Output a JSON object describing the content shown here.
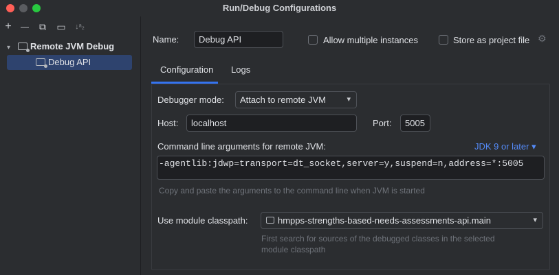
{
  "window": {
    "title": "Run/Debug Configurations"
  },
  "toolbar": {
    "add": "+",
    "remove": "—",
    "copy": "⧉",
    "new_folder": "▭",
    "sort": "↓ᵃ₂"
  },
  "tree": {
    "parent_label": "Remote JVM Debug",
    "child_label": "Debug API"
  },
  "form": {
    "name_label": "Name:",
    "name_value": "Debug API",
    "allow_multiple_label": "Allow multiple instances",
    "store_project_label": "Store as project file",
    "tabs": [
      {
        "label": "Configuration"
      },
      {
        "label": "Logs"
      }
    ],
    "debugger_mode_label": "Debugger mode:",
    "debugger_mode_value": "Attach to remote JVM",
    "host_label": "Host:",
    "host_value": "localhost",
    "port_label": "Port:",
    "port_value": "5005",
    "cmd_label": "Command line arguments for remote JVM:",
    "jdk_link": "JDK 9 or later",
    "cmd_value": "-agentlib:jdwp=transport=dt_socket,server=y,suspend=n,address=*:5005",
    "cmd_hint": "Copy and paste the arguments to the command line when JVM is started",
    "module_label": "Use module classpath:",
    "module_value": "hmpps-strengths-based-needs-assessments-api.main",
    "module_hint_1": "First search for sources of the debugged classes in the selected",
    "module_hint_2": "module classpath"
  },
  "icons": {
    "chevron_down": "▾",
    "tree_expand": "⌄",
    "gear": "⚙"
  },
  "colors": {
    "accent": "#3574f0",
    "selection": "#2e436e",
    "link": "#548af7"
  }
}
